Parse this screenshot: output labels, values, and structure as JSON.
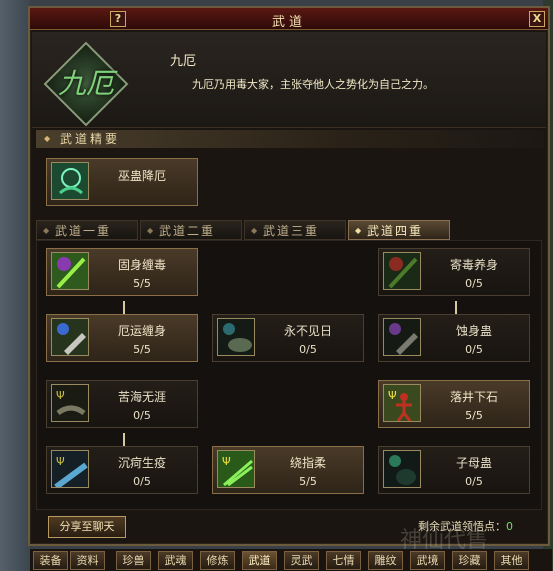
{
  "window": {
    "title": "武道",
    "help": "?",
    "close": "X"
  },
  "header": {
    "emblem_glyph": "九厄",
    "skill_title": "九厄",
    "skill_desc": "九厄乃用毒大家，主张夺他人之势化为自己之力。"
  },
  "essentials": {
    "heading": "武道精要",
    "skill": {
      "name": "巫蛊降厄",
      "icon": "green-swirl-icon"
    }
  },
  "tabs": [
    "武道一重",
    "武道二重",
    "武道三重",
    "武道四重"
  ],
  "active_tab": 3,
  "skills": {
    "gushen": {
      "name": "固身缠毒",
      "level": "5/5",
      "icon": "purple-claw-icon"
    },
    "jidu": {
      "name": "寄毒养身",
      "level": "0/5",
      "icon": "red-claw-icon"
    },
    "eyun": {
      "name": "厄运缠身",
      "level": "5/5",
      "icon": "blue-bracer-icon"
    },
    "yongbu": {
      "name": "永不见日",
      "level": "0/5",
      "icon": "dark-orb-icon"
    },
    "shishen": {
      "name": "蚀身蛊",
      "level": "0/5",
      "icon": "purple-bracer-icon"
    },
    "kuhai": {
      "name": "苦海无涯",
      "level": "0/5",
      "icon": "rope-icon"
    },
    "luojing": {
      "name": "落井下石",
      "level": "5/5",
      "icon": "red-figure-icon"
    },
    "chenke": {
      "name": "沉疴生疫",
      "level": "0/5",
      "icon": "blue-slash-icon"
    },
    "raozhi": {
      "name": "绕指柔",
      "level": "5/5",
      "icon": "green-ribbon-icon"
    },
    "zimu": {
      "name": "子母蛊",
      "level": "0/5",
      "icon": "green-orb-icon"
    }
  },
  "footer": {
    "share_label": "分享至聊天",
    "remaining_label": "剩余武道领悟点：",
    "remaining_value": "0"
  },
  "bottom_tabs": [
    "装备",
    "资料",
    "珍兽",
    "武魂",
    "修炼",
    "武道",
    "灵武",
    "七情",
    "雕纹",
    "武境",
    "珍藏",
    "其他"
  ],
  "bottom_active": 5,
  "watermark": "神仙代售"
}
